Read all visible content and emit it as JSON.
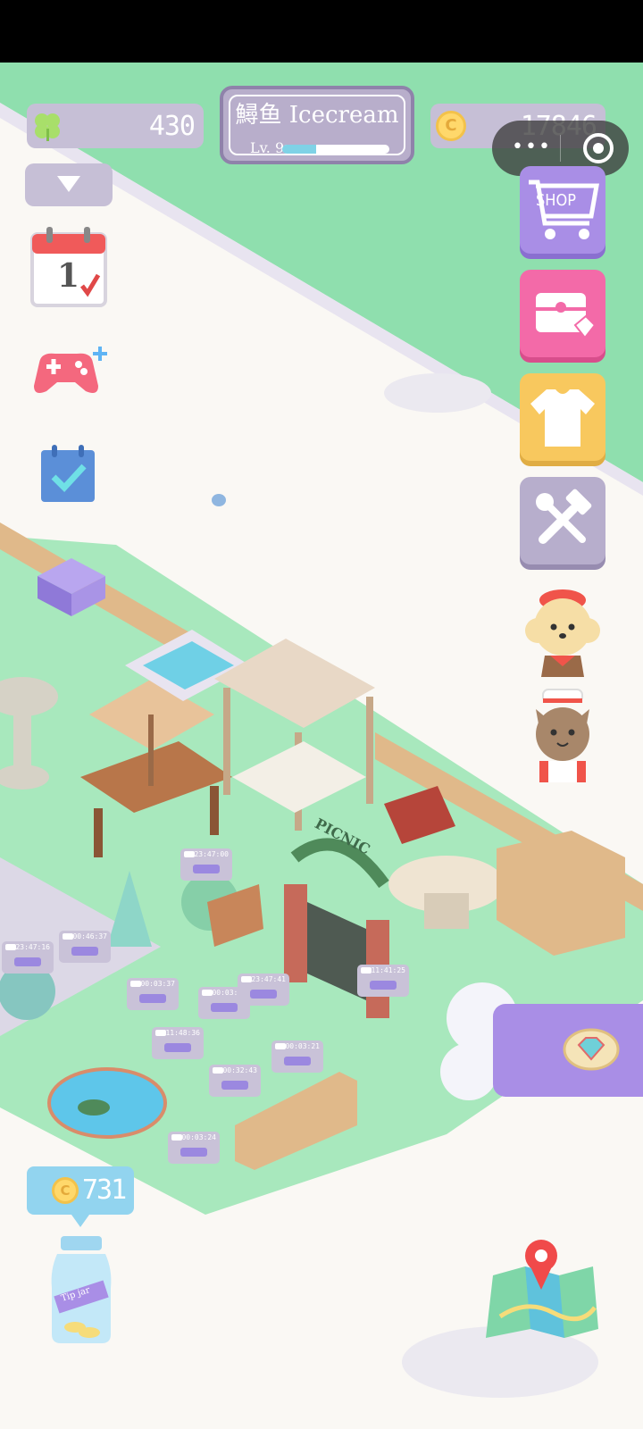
{
  "hud": {
    "clovers": "430",
    "coins": "17846",
    "coin_symbol": "C",
    "player_name": "鱘鱼 Icecream",
    "level": "Lv. 9",
    "xp_fraction": 0.32
  },
  "left_menu": {
    "calendar_day": "1"
  },
  "right_menu": {
    "shop_label": "SHOP"
  },
  "scene": {
    "picnic_sign": "PICNIC",
    "timers": [
      "23:47:00",
      "00:46:37",
      "23:47:16",
      "00:03:37",
      "00:03:27",
      "23:47:41",
      "11:41:25",
      "11:48:36",
      "00:03:21",
      "00:32:43",
      "00:03:24"
    ]
  },
  "tip_jar": {
    "coins": "731",
    "coin_symbol": "C",
    "jar_label": "Tip jar"
  },
  "colors": {
    "grass": "#8fdfae",
    "lawn": "#a8e8bd",
    "path": "#faf8f4",
    "hud": "#c6bfd6",
    "shop": "#a98ee6",
    "gift": "#f36aa8",
    "wardrobe": "#f8c85e",
    "tools": "#b7aecc"
  }
}
